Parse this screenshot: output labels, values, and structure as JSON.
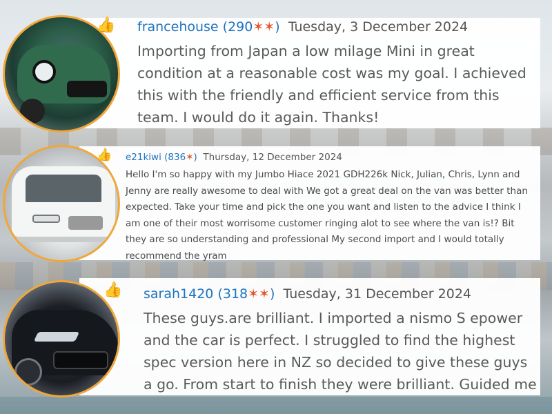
{
  "reviews": [
    {
      "username": "francehouse",
      "rating": "(290",
      "rating_close": ")",
      "date": "Tuesday, 3 December 2024",
      "text": "Importing from Japan a low milage Mini in great condition at a reasonable cost was my goal. I achieved this with the friendly and efficient service from this team. I would do it again. Thanks!",
      "avatar_icon": "green-mini-car-photo"
    },
    {
      "username": "e21kiwi",
      "rating": "(836",
      "rating_close": ")",
      "date": "Thursday, 12 December 2024",
      "text": "Hello I'm so happy with my Jumbo Hiace 2021 GDH226k Nick, Julian, Chris, Lynn and Jenny are really awesome to deal with We got a great deal on the van was better than expected. Take your time and pick the one you want and listen to the advice I think I am one of their most worrisome customer ringing alot to see where the van is!? Bit they are so understanding and professional My second import and I would totally recommend the yram",
      "avatar_icon": "white-hiace-van-photo"
    },
    {
      "username": "sarah1420",
      "rating": "(318",
      "rating_close": ")",
      "date": "Tuesday, 31 December 2024",
      "text": "These guys.are brilliant. I imported a nismo S epower and the car is perfect. I struggled to find the highest spec version here in NZ so decided to give these guys a go. From start to finish they were brilliant. Guided me",
      "avatar_icon": "black-corolla-car-photo"
    }
  ],
  "colors": {
    "username": "#1e73be",
    "star": "#e2572b",
    "avatar_ring": "#f0a73a",
    "thumb": "#4aa24f"
  }
}
